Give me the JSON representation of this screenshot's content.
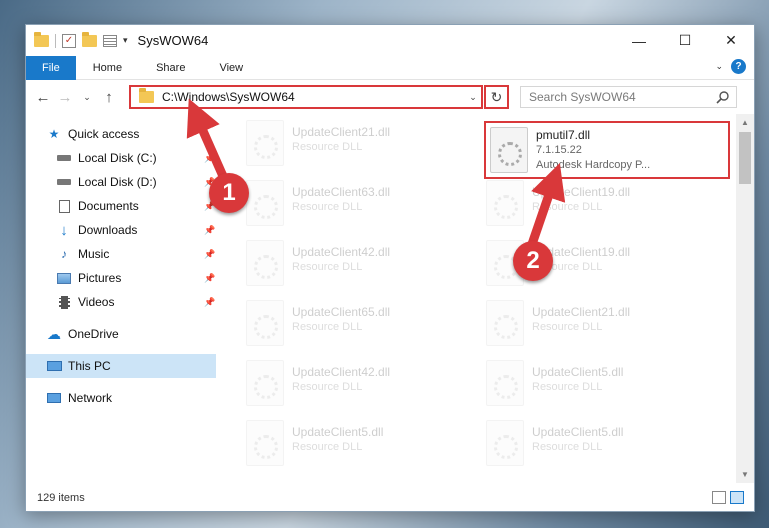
{
  "window": {
    "title": "SysWOW64"
  },
  "ribbon": {
    "tabs": [
      "File",
      "Home",
      "Share",
      "View"
    ]
  },
  "address": {
    "path": "C:\\Windows\\SysWOW64"
  },
  "search": {
    "placeholder": "Search SysWOW64"
  },
  "sidebar": {
    "quick_access": "Quick access",
    "items": [
      {
        "label": "Local Disk (C:)",
        "icon": "drive-icon"
      },
      {
        "label": "Local Disk (D:)",
        "icon": "drive-icon"
      },
      {
        "label": "Documents",
        "icon": "documents-icon"
      },
      {
        "label": "Downloads",
        "icon": "download-icon"
      },
      {
        "label": "Music",
        "icon": "music-icon"
      },
      {
        "label": "Pictures",
        "icon": "pictures-icon"
      },
      {
        "label": "Videos",
        "icon": "videos-icon"
      }
    ],
    "onedrive": "OneDrive",
    "this_pc": "This PC",
    "network": "Network"
  },
  "files": {
    "highlighted": {
      "name": "pmutil7.dll",
      "version": "7.1.15.22",
      "desc": "Autodesk Hardcopy P..."
    },
    "left": [
      {
        "name": "UpdateClient21.dll",
        "type": "Resource DLL"
      },
      {
        "name": "UpdateClient63.dll",
        "type": "Resource DLL"
      },
      {
        "name": "UpdateClient42.dll",
        "type": "Resource DLL"
      },
      {
        "name": "UpdateClient65.dll",
        "type": "Resource DLL"
      },
      {
        "name": "UpdateClient42.dll",
        "type": "Resource DLL"
      },
      {
        "name": "UpdateClient5.dll",
        "type": "Resource DLL"
      }
    ],
    "right": [
      {
        "name": "UpdateClient19.dll",
        "type": "Resource DLL"
      },
      {
        "name": "UpdateClient19.dll",
        "type": "Resource DLL"
      },
      {
        "name": "UpdateClient21.dll",
        "type": "Resource DLL"
      },
      {
        "name": "UpdateClient5.dll",
        "type": "Resource DLL"
      },
      {
        "name": "UpdateClient5.dll",
        "type": "Resource DLL"
      }
    ]
  },
  "status": {
    "count": "129 items"
  },
  "callouts": [
    "1",
    "2"
  ],
  "colors": {
    "accent": "#1979ca",
    "highlight": "#d9383a",
    "selection": "#cce4f7"
  }
}
